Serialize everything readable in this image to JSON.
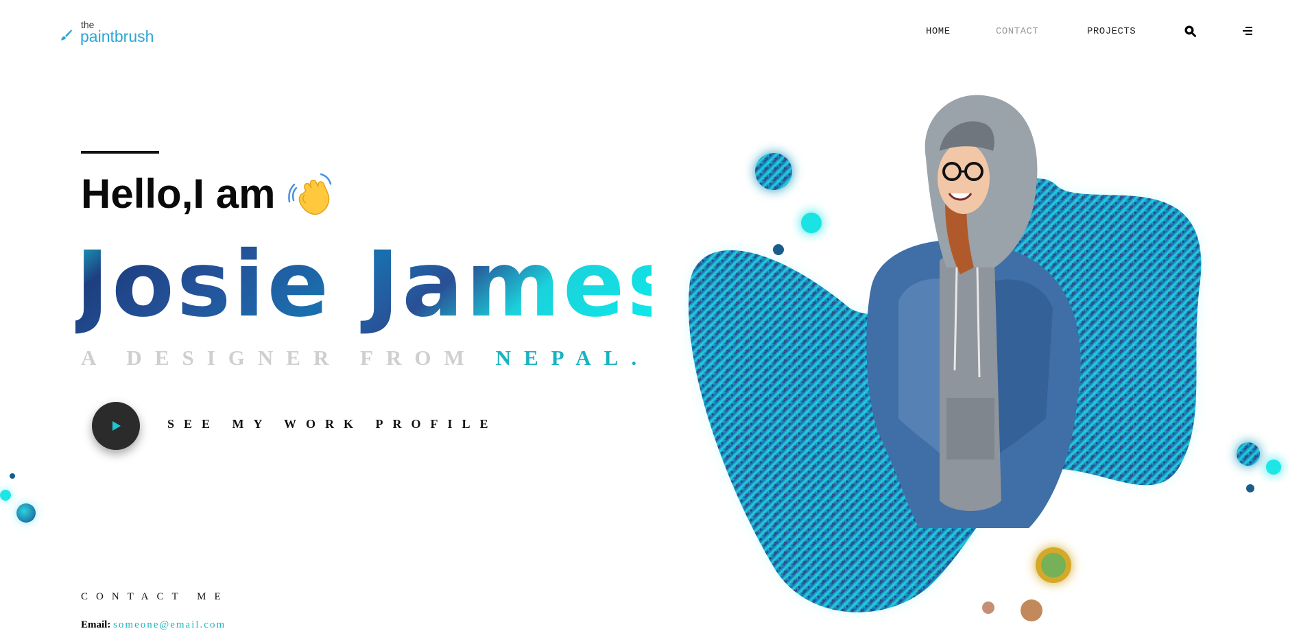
{
  "logo": {
    "small": "the",
    "name": "paintbrush"
  },
  "nav": {
    "items": [
      {
        "label": "HOME"
      },
      {
        "label": "CONTACT"
      },
      {
        "label": "PROJECTS"
      }
    ],
    "icons": {
      "search": "search-icon",
      "menu": "menu-icon"
    }
  },
  "hero": {
    "greeting": "Hello,I am",
    "wave": "waving-hand-icon",
    "name": "Josie James,",
    "tagline_prefix": "A DESIGNER FROM ",
    "tagline_place": "NEPAL.",
    "cta_label": "SEE MY WORK PROFILE",
    "cta_icon": "play-icon"
  },
  "contact": {
    "title": "CONTACT ME",
    "email_label": "Email:",
    "email_value": "someone@email.com"
  },
  "colors": {
    "accent": "#17b3c0",
    "brand": "#2aa7d6",
    "dark": "#2b2b2b",
    "cyan": "#1fe3e6",
    "navy": "#1a3f86"
  }
}
